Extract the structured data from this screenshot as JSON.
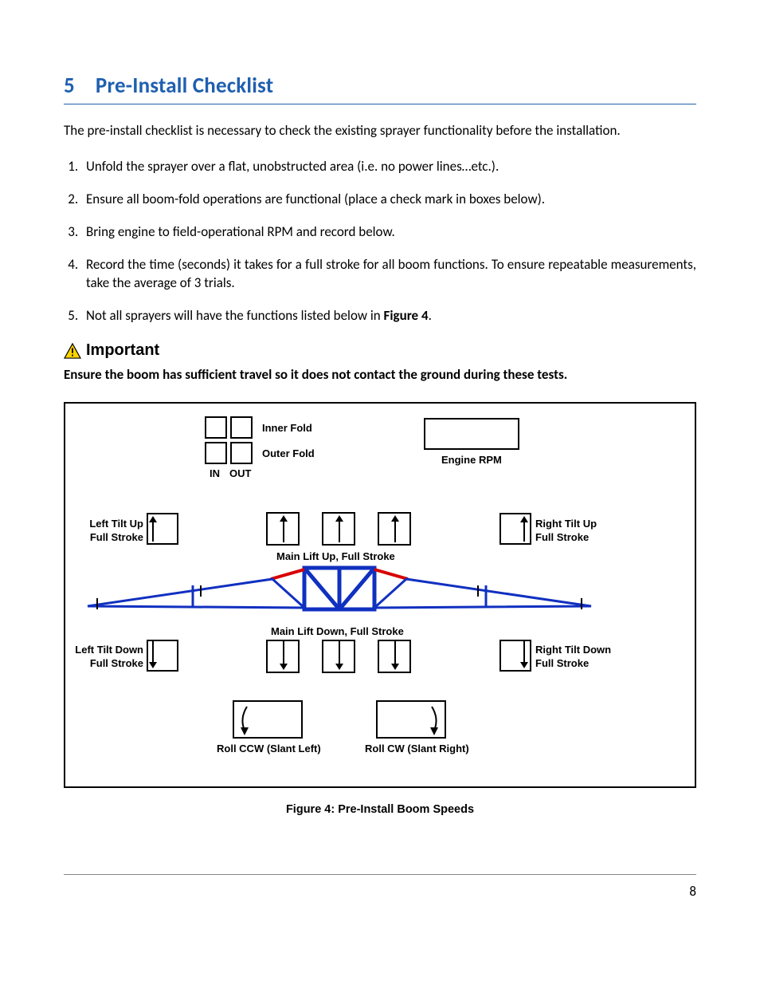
{
  "heading": {
    "number": "5",
    "title": "Pre-Install Checklist"
  },
  "intro": "The pre-install checklist is necessary to check the existing sprayer functionality before the installation.",
  "steps": [
    "Unfold the sprayer over a flat, unobstructed area (i.e. no power lines…etc.).",
    "Ensure all boom-fold operations are functional (place a check mark in boxes below).",
    "Bring engine to field-operational RPM and record below.",
    "Record the time (seconds) it takes for a full stroke for all boom functions.  To ensure repeatable measurements, take the average of 3 trials.",
    "Not all sprayers will have the functions listed below in "
  ],
  "figure_ref": "Figure 4",
  "important": {
    "title": "Important",
    "text": "Ensure the boom has sufficient travel so it does not contact the ground during these tests."
  },
  "figure": {
    "inner_fold": "Inner Fold",
    "outer_fold": "Outer Fold",
    "in": "IN",
    "out": "OUT",
    "engine_rpm": "Engine RPM",
    "left_tilt_up": "Left Tilt Up\nFull Stroke",
    "right_tilt_up": "Right Tilt Up\nFull Stroke",
    "main_lift_up": "Main Lift Up, Full Stroke",
    "main_lift_down": "Main Lift Down, Full Stroke",
    "left_tilt_down": "Left Tilt Down\nFull Stroke",
    "right_tilt_down": "Right Tilt  Down\nFull Stroke",
    "roll_ccw": "Roll CCW (Slant Left)",
    "roll_cw": "Roll CW (Slant Right)",
    "caption": "Figure 4: Pre-Install Boom Speeds"
  },
  "page_number": "8"
}
